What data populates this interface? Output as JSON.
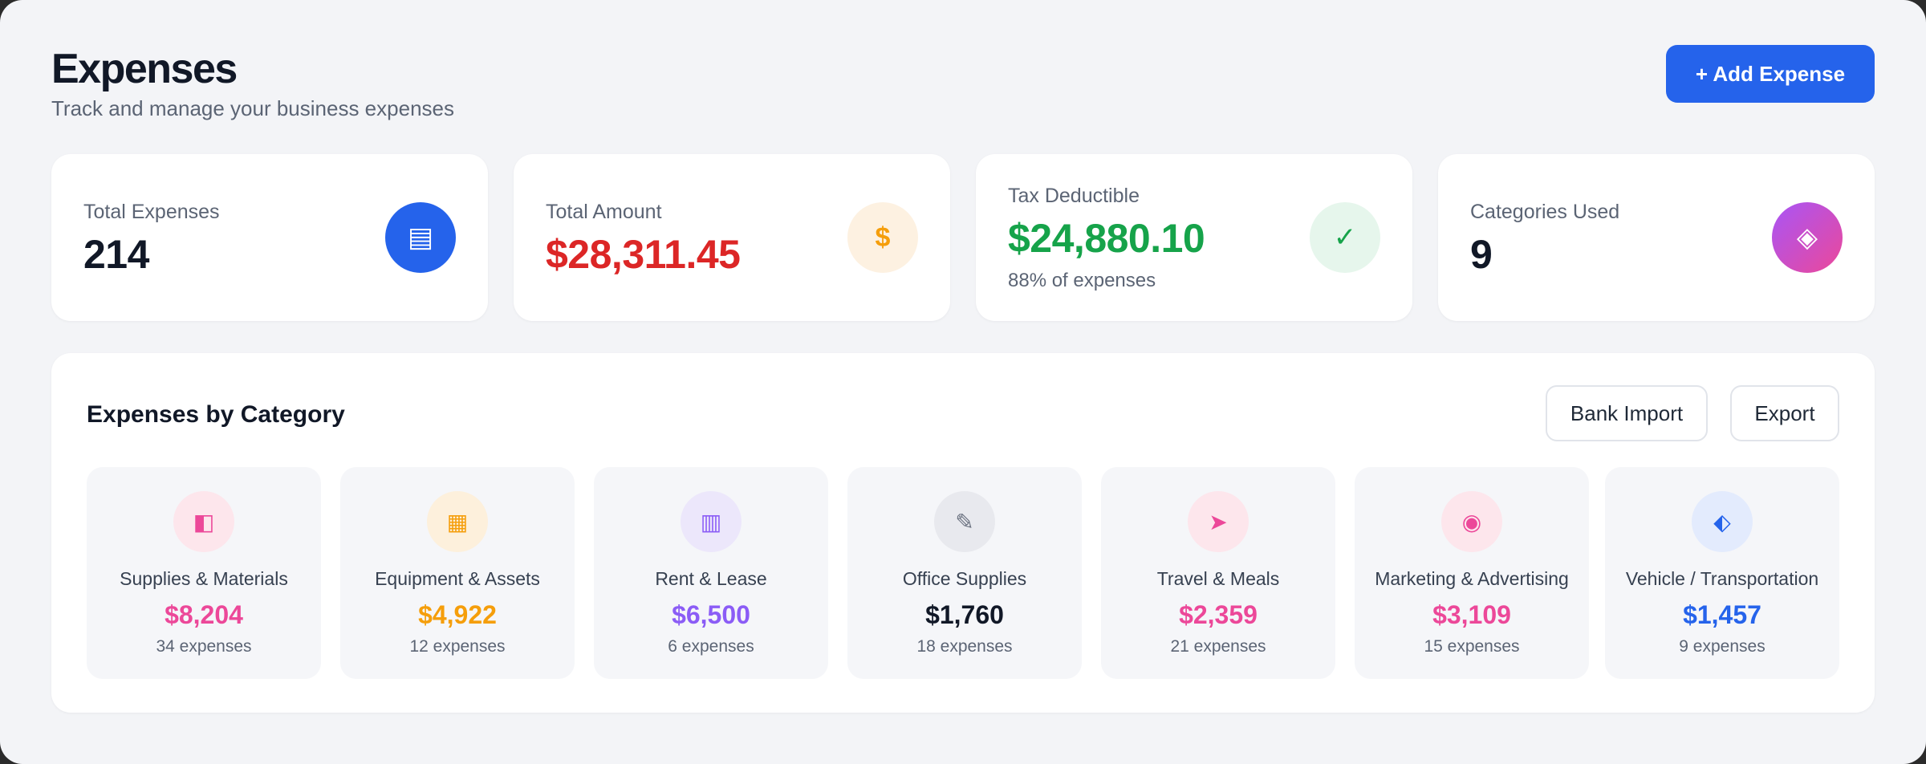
{
  "header": {
    "title": "Expenses",
    "subtitle": "Track and manage your business expenses",
    "add_button_label": "+ Add Expense"
  },
  "stats": [
    {
      "label": "Total Expenses",
      "value": "214",
      "note": "",
      "icon": "document-icon",
      "icon_glyph": "▤",
      "value_color": "#111827",
      "icon_bg": "#2563eb",
      "icon_color": "#ffffff"
    },
    {
      "label": "Total Amount",
      "value": "$28,311.45",
      "note": "",
      "icon": "dollar-icon",
      "icon_glyph": "$",
      "value_color": "#dc2626",
      "icon_bg": "#fdf1e1",
      "icon_color": "#f59e0b"
    },
    {
      "label": "Tax Deductible",
      "value": "$24,880.10",
      "note": "88% of expenses",
      "icon": "checkmark-icon",
      "icon_glyph": "✓",
      "value_color": "#16a34a",
      "icon_bg": "#e6f6ec",
      "icon_color": "#16a34a"
    },
    {
      "label": "Categories Used",
      "value": "9",
      "note": "",
      "icon": "diamond-icon",
      "icon_glyph": "◈",
      "value_color": "#111827",
      "icon_bg": "#a855f7",
      "icon_color": "#ffffff"
    }
  ],
  "panel": {
    "title": "Expenses by Category",
    "bank_import_label": "Bank Import",
    "export_label": "Export"
  },
  "categories": [
    {
      "name": "Supplies & Materials",
      "amount": "$8,204",
      "count": "34 expenses",
      "icon": "supplies-icon",
      "icon_glyph": "◧",
      "color": "#ec4899",
      "icon_bg": "#fde6ec"
    },
    {
      "name": "Equipment & Assets",
      "amount": "$4,922",
      "count": "12 expenses",
      "icon": "equipment-icon",
      "icon_glyph": "▦",
      "color": "#f59e0b",
      "icon_bg": "#fdf0dc"
    },
    {
      "name": "Rent & Lease",
      "amount": "$6,500",
      "count": "6 expenses",
      "icon": "building-icon",
      "icon_glyph": "▥",
      "color": "#8b5cf6",
      "icon_bg": "#ece7fb"
    },
    {
      "name": "Office Supplies",
      "amount": "$1,760",
      "count": "18 expenses",
      "icon": "pencil-icon",
      "icon_glyph": "✎",
      "color": "#111827",
      "icon_bg": "#e8e9ee"
    },
    {
      "name": "Travel & Meals",
      "amount": "$2,359",
      "count": "21 expenses",
      "icon": "plane-icon",
      "icon_glyph": "➤",
      "color": "#ec4899",
      "icon_bg": "#fde6ec"
    },
    {
      "name": "Marketing & Advertising",
      "amount": "$3,109",
      "count": "15 expenses",
      "icon": "target-icon",
      "icon_glyph": "◉",
      "color": "#ec4899",
      "icon_bg": "#fde6ec"
    },
    {
      "name": "Vehicle / Transportation",
      "amount": "$1,457",
      "count": "9 expenses",
      "icon": "vehicle-icon",
      "icon_glyph": "⬖",
      "color": "#2563eb",
      "icon_bg": "#e3ebfd"
    }
  ]
}
